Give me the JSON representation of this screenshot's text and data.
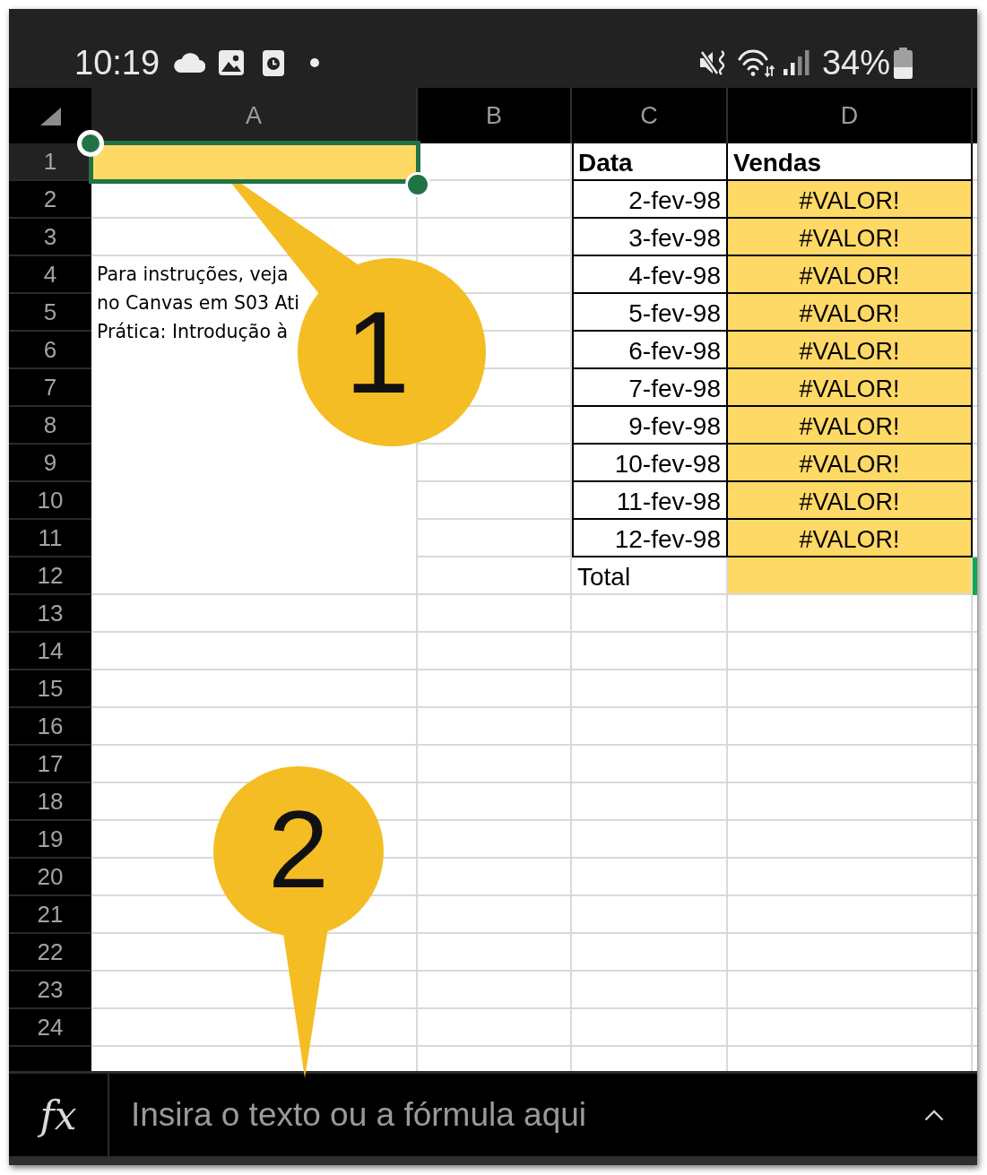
{
  "status_bar": {
    "time": "10:19",
    "battery_percent": "34%"
  },
  "sheet": {
    "columns": [
      {
        "label": "A",
        "selected": true
      },
      {
        "label": "B",
        "selected": false
      },
      {
        "label": "C",
        "selected": false
      },
      {
        "label": "D",
        "selected": false
      }
    ],
    "rows": [
      {
        "label": "1",
        "selected": true
      },
      {
        "label": "2",
        "selected": false
      },
      {
        "label": "3",
        "selected": false
      },
      {
        "label": "4",
        "selected": false
      },
      {
        "label": "5",
        "selected": false
      },
      {
        "label": "6",
        "selected": false
      },
      {
        "label": "7",
        "selected": false
      },
      {
        "label": "8",
        "selected": false
      },
      {
        "label": "9",
        "selected": false
      },
      {
        "label": "10",
        "selected": false
      },
      {
        "label": "11",
        "selected": false
      },
      {
        "label": "12",
        "selected": false
      },
      {
        "label": "13",
        "selected": false
      },
      {
        "label": "14",
        "selected": false
      },
      {
        "label": "15",
        "selected": false
      },
      {
        "label": "16",
        "selected": false
      },
      {
        "label": "17",
        "selected": false
      },
      {
        "label": "18",
        "selected": false
      },
      {
        "label": "19",
        "selected": false
      },
      {
        "label": "20",
        "selected": false
      },
      {
        "label": "21",
        "selected": false
      },
      {
        "label": "22",
        "selected": false
      },
      {
        "label": "23",
        "selected": false
      },
      {
        "label": "24",
        "selected": false
      }
    ],
    "active_cell": {
      "highlighted": true
    },
    "note": [
      "Para instruções, veja",
      "no Canvas em S03 Ati",
      "Prática: Introdução à"
    ],
    "table": {
      "columns": [
        {
          "label": "Data"
        },
        {
          "label": "Vendas"
        }
      ],
      "rows": [
        {
          "date": "2-fev-98",
          "sales": "#VALOR!",
          "highlighted": true
        },
        {
          "date": "3-fev-98",
          "sales": "#VALOR!",
          "highlighted": true
        },
        {
          "date": "4-fev-98",
          "sales": "#VALOR!",
          "highlighted": true
        },
        {
          "date": "5-fev-98",
          "sales": "#VALOR!",
          "highlighted": true
        },
        {
          "date": "6-fev-98",
          "sales": "#VALOR!",
          "highlighted": true
        },
        {
          "date": "7-fev-98",
          "sales": "#VALOR!",
          "highlighted": true
        },
        {
          "date": "9-fev-98",
          "sales": "#VALOR!",
          "highlighted": true
        },
        {
          "date": "10-fev-98",
          "sales": "#VALOR!",
          "highlighted": true
        },
        {
          "date": "11-fev-98",
          "sales": "#VALOR!",
          "highlighted": true
        },
        {
          "date": "12-fev-98",
          "sales": "#VALOR!",
          "highlighted": true
        }
      ],
      "total": {
        "label": "Total",
        "highlighted": true,
        "next_cell_filled": true
      }
    }
  },
  "callouts": [
    {
      "number": "1"
    },
    {
      "number": "2"
    }
  ],
  "formula_bar": {
    "function_label": "fx",
    "placeholder": "Insira o texto ou a fórmula aqui"
  }
}
